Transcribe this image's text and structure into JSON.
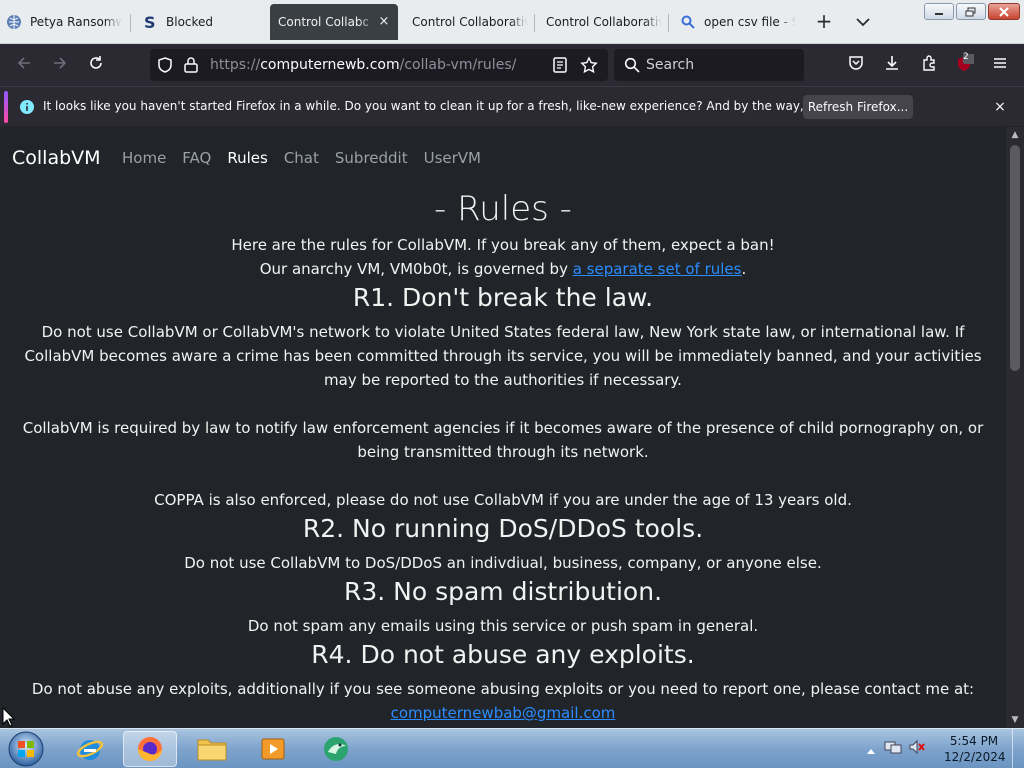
{
  "browser": {
    "tabs": [
      {
        "label": "Petya Ransomwa",
        "icon": "globe-icon"
      },
      {
        "label": "Blocked",
        "icon": "s-logo-icon"
      },
      {
        "label": "Control Collabora",
        "icon": "none",
        "active": true,
        "close": "×"
      },
      {
        "label": "Control Collaborative",
        "icon": "none"
      },
      {
        "label": "Control Collaborative",
        "icon": "none"
      },
      {
        "label": "open csv file - Se",
        "icon": "search-icon"
      }
    ],
    "new_tab": "+",
    "url_scheme": "https://",
    "url_domain": "computernewb.com",
    "url_path": "/collab-vm/rules/",
    "search_placeholder": "Search",
    "extension_badge": "2"
  },
  "notification": {
    "message": "It looks like you haven't started Firefox in a while. Do you want to clean it up for a fresh, like-new experience? And by the way, welcome back!",
    "button": "Refresh Firefox...",
    "close": "×"
  },
  "site": {
    "brand": "CollabVM",
    "nav": [
      "Home",
      "FAQ",
      "Rules",
      "Chat",
      "Subreddit",
      "UserVM"
    ],
    "active_nav": "Rules"
  },
  "content": {
    "title": "- Rules -",
    "intro1": "Here are the rules for CollabVM. If you break any of them, expect a ban!",
    "intro2_before": "Our anarchy VM, VM0b0t, is governed by ",
    "intro2_link": "a separate set of rules",
    "intro2_after": ".",
    "r1_title": "R1. Don't break the law.",
    "r1_p1": "Do not use CollabVM or CollabVM's network to violate United States federal law, New York state law, or international law. If CollabVM becomes aware a crime has been committed through its service, you will be immediately banned, and your activities may be reported to the authorities if necessary.",
    "r1_p2": "CollabVM is required by law to notify law enforcement agencies if it becomes aware of the presence of child pornography on, or being transmitted through its network.",
    "r1_p3": "COPPA is also enforced, please do not use CollabVM if you are under the age of 13 years old.",
    "r2_title": "R2. No running DoS/DDoS tools.",
    "r2_p": "Do not use CollabVM to DoS/DDoS an indivdiual, business, company, or anyone else.",
    "r3_title": "R3. No spam distribution.",
    "r3_p": "Do not spam any emails using this service or push spam in general.",
    "r4_title": "R4. Do not abuse any exploits.",
    "r4_p": "Do not abuse any exploits, additionally if you see someone abusing exploits or you need to report one, please contact me at:",
    "r4_email": "computernewbab@gmail.com"
  },
  "taskbar": {
    "time": "5:54 PM",
    "date": "12/2/2024"
  }
}
